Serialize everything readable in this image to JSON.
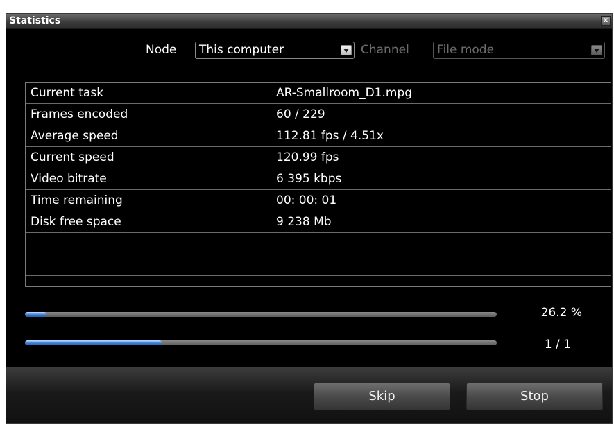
{
  "window": {
    "title": "Statistics",
    "close_glyph": "x"
  },
  "controls": {
    "node_label": "Node",
    "node_value": "This computer",
    "channel_label": "Channel",
    "channel_value": "File mode"
  },
  "stats": {
    "rows": [
      {
        "label": "Current task",
        "value": "AR-Smallroom_D1.mpg"
      },
      {
        "label": "Frames encoded",
        "value": "60 / 229"
      },
      {
        "label": "Average speed",
        "value": "112.81 fps /  4.51x"
      },
      {
        "label": "Current speed",
        "value": "120.99 fps"
      },
      {
        "label": "Video bitrate",
        "value": "6 395 kbps"
      },
      {
        "label": "Time remaining",
        "value": "00: 00: 01"
      },
      {
        "label": "Disk free space",
        "value": "9 238 Mb"
      },
      {
        "label": "",
        "value": ""
      },
      {
        "label": "",
        "value": ""
      }
    ]
  },
  "progress": {
    "task_percent_text": "26.2 %",
    "task_fraction": 0.045,
    "job_text": "1 / 1",
    "job_fraction": 0.29
  },
  "buttons": {
    "skip": "Skip",
    "stop": "Stop"
  },
  "colors": {
    "text": "#ffffff",
    "disabled_text": "#6b6b6b",
    "accent": "#3e7fd6",
    "background": "#000000"
  },
  "icons": {
    "close": "close-icon",
    "dropdown": "chevron-down-icon"
  }
}
